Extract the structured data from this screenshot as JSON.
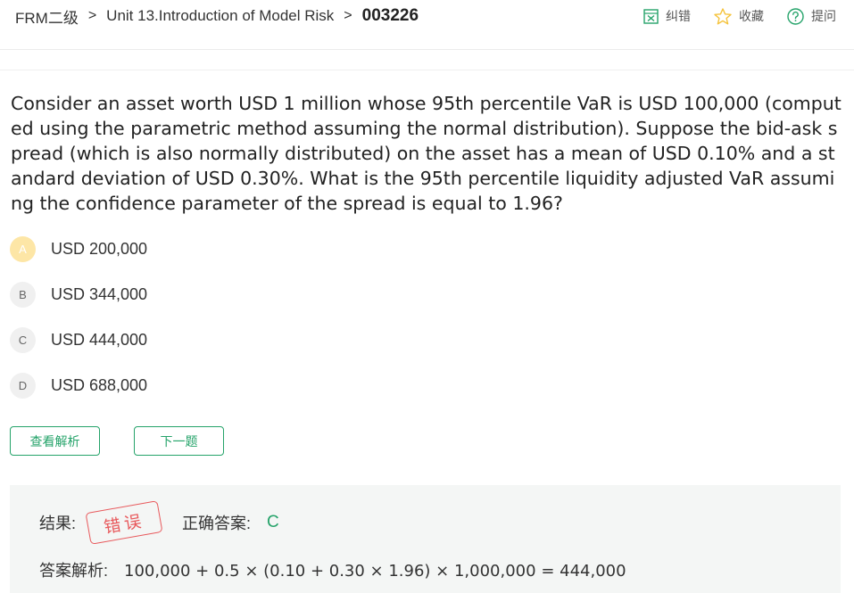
{
  "breadcrumb": {
    "course": "FRM二级",
    "separator": ">",
    "chapter": "Unit 13.Introduction of Model Risk",
    "question_id": "003226"
  },
  "toolbar": {
    "report_label": "纠错",
    "favorite_label": "收藏",
    "ask_label": "提问"
  },
  "question": {
    "text": "Consider an asset worth USD 1 million whose 95th percentile VaR is USD 100,000 (computed using the parametric method assuming the normal distribution). Suppose the bid-ask spread (which is also normally distributed) on the asset has a mean of USD 0.10% and a standard deviation of USD 0.30%. What is the 95th percentile liquidity adjusted VaR assuming the confidence parameter of the spread is equal to 1.96?"
  },
  "options": [
    {
      "letter": "A",
      "text": "USD 200,000",
      "selected": true
    },
    {
      "letter": "B",
      "text": "USD 344,000",
      "selected": false
    },
    {
      "letter": "C",
      "text": "USD 444,000",
      "selected": false
    },
    {
      "letter": "D",
      "text": "USD 688,000",
      "selected": false
    }
  ],
  "buttons": {
    "view_analysis": "查看解析",
    "next_question": "下一题"
  },
  "result": {
    "result_label": "结果:",
    "result_stamp": "错误",
    "correct_label": "正确答案:",
    "correct_value": "C",
    "analysis_label": "答案解析:",
    "analysis_text": "100,000 + 0.5 × (0.10 + 0.30 × 1.96) × 1,000,000 = 444,000"
  },
  "colors": {
    "accent_green": "#25a36a",
    "wrong_red": "#e8595c",
    "selected_option": "#fde6a6",
    "star_yellow": "#f5c33b"
  }
}
